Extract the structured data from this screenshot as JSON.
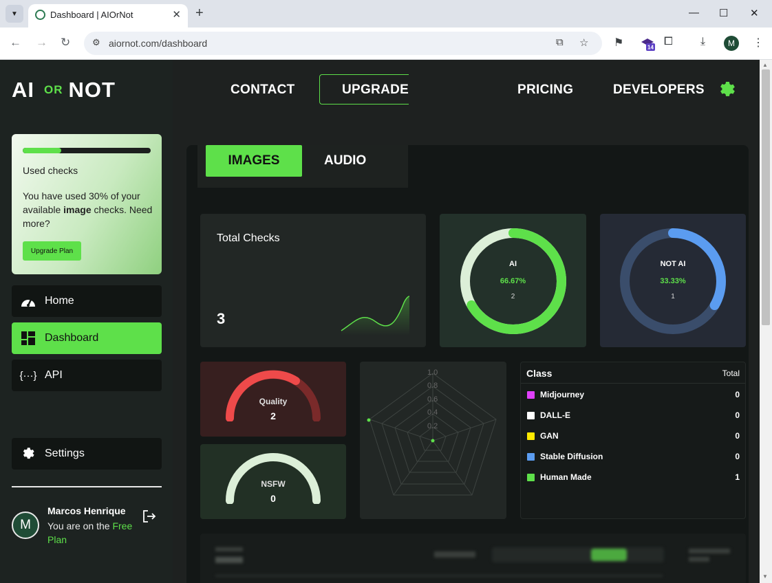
{
  "browser": {
    "tab_title": "Dashboard | AIOrNot",
    "url": "aiornot.com/dashboard",
    "extension_badge": "14",
    "profile_initial": "M"
  },
  "sidebar": {
    "logo": {
      "left": "AI",
      "middle": "OR",
      "right": "NOT"
    },
    "usage": {
      "used_fraction": 0.3,
      "title": "Used checks",
      "desc_before": "You have used 30% of your available ",
      "desc_bold": "image",
      "desc_after": " checks. Need more?",
      "button": "Upgrade Plan"
    },
    "nav": [
      {
        "label": "Home",
        "icon": "dashboard-gauge-icon"
      },
      {
        "label": "Dashboard",
        "icon": "grid-layout-icon",
        "active": true
      },
      {
        "label": "API",
        "icon": "code-braces-icon"
      },
      {
        "label": "Settings",
        "icon": "gear-icon"
      }
    ],
    "user": {
      "initial": "M",
      "name": "Marcos Henrique",
      "plan_prefix": "You are on the ",
      "plan_name": "Free Plan"
    }
  },
  "topnav": {
    "contact": "CONTACT",
    "upgrade": "UPGRADE",
    "pricing": "PRICING",
    "developers": "DEVELOPERS"
  },
  "tabs": {
    "images": "IMAGES",
    "audio": "AUDIO"
  },
  "stats": {
    "total_title": "Total Checks",
    "total_value": "3",
    "ai": {
      "label": "AI",
      "percent": "66.67%",
      "count": "2",
      "fraction": 0.6667
    },
    "not_ai": {
      "label": "NOT AI",
      "percent": "33.33%",
      "count": "1",
      "fraction": 0.3333
    },
    "quality": {
      "label": "Quality",
      "value": "2"
    },
    "nsfw": {
      "label": "NSFW",
      "value": "0"
    }
  },
  "radar": {
    "ticks": [
      "1.0",
      "0.8",
      "0.6",
      "0.4",
      "0.2"
    ]
  },
  "class_table": {
    "header_class": "Class",
    "header_total": "Total",
    "rows": [
      {
        "name": "Midjourney",
        "total": "0",
        "color": "#e040fb"
      },
      {
        "name": "DALL-E",
        "total": "0",
        "color": "#ffffff"
      },
      {
        "name": "GAN",
        "total": "0",
        "color": "#ffea00"
      },
      {
        "name": "Stable Diffusion",
        "total": "0",
        "color": "#5b9cf0"
      },
      {
        "name": "Human Made",
        "total": "1",
        "color": "#5ee04a"
      }
    ]
  },
  "colors": {
    "accent": "#5ee04a",
    "blue": "#5b9cf0",
    "red": "#ee4a4a"
  }
}
